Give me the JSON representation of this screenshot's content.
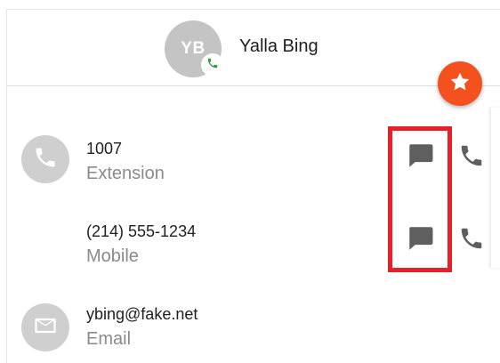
{
  "contact": {
    "initials": "YB",
    "name": "Yalla Bing"
  },
  "rows": [
    {
      "value": "1007",
      "type": "Extension"
    },
    {
      "value": "(214) 555-1234",
      "type": "Mobile"
    },
    {
      "value": "ybing@fake.net",
      "type": "Email"
    }
  ],
  "icons": {
    "avatar_badge": "phone-icon",
    "favorite": "star-icon",
    "row_phone": "phone-icon",
    "row_email": "mail-icon",
    "message": "message-icon",
    "call": "phone-icon"
  },
  "colors": {
    "accent": "#f4511e",
    "highlight": "#e8202a",
    "badge_phone": "#2e9e3e",
    "icon_grey": "#5f5f5f"
  }
}
